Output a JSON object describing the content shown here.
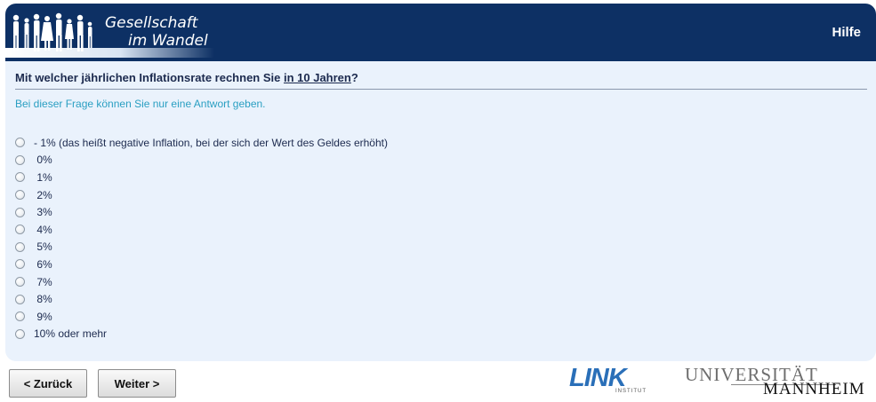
{
  "header": {
    "brand_line1": "Gesellschaft",
    "brand_line2": "im Wandel",
    "help_label": "Hilfe",
    "color": "#0d3064"
  },
  "question": {
    "text_before": "Mit welcher jährlichen Inflationsrate rechnen Sie ",
    "text_underlined": "in 10 Jahren",
    "text_after": "?",
    "instruction": "Bei dieser Frage können Sie nur eine Antwort geben."
  },
  "options": [
    {
      "label": "- 1% (das heißt negative Inflation, bei der sich der Wert des Geldes erhöht)"
    },
    {
      "label": " 0%"
    },
    {
      "label": " 1%"
    },
    {
      "label": " 2%"
    },
    {
      "label": " 3%"
    },
    {
      "label": " 4%"
    },
    {
      "label": " 5%"
    },
    {
      "label": " 6%"
    },
    {
      "label": " 7%"
    },
    {
      "label": " 8%"
    },
    {
      "label": " 9%"
    },
    {
      "label": "10% oder mehr"
    }
  ],
  "nav": {
    "back_label": "< Zurück",
    "next_label": "Weiter >"
  },
  "footer": {
    "link_logo": "LINK",
    "link_sub": "INSTITUT",
    "uni_line1": "UNIVERSITÄT",
    "uni_line2": "MANNHEIM"
  }
}
